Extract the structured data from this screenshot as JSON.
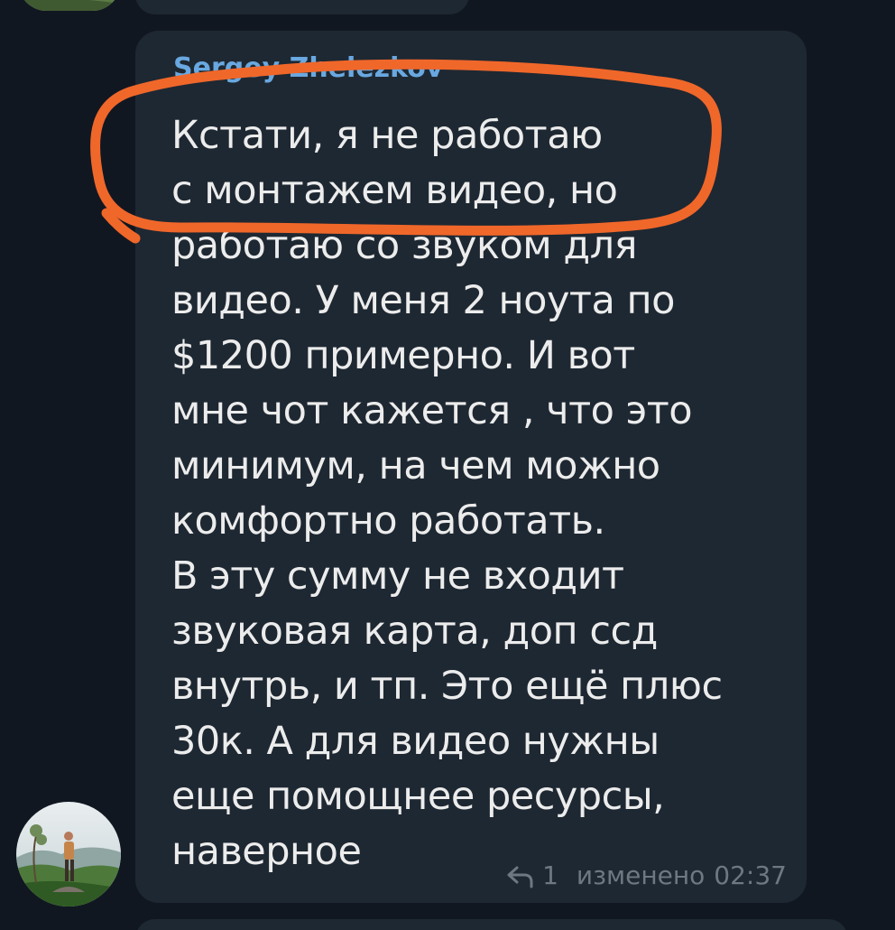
{
  "message": {
    "sender": "Sergey Zhelezkov",
    "text": "Кстати, я не работаю\nс монтажем видео, но\nработаю со звуком для\nвидео. У меня 2 ноута по\n$1200 примерно. И вот\nмне чот кажется , что это\nминимум, на чем можно\nкомфортно работать.\nВ эту сумму не входит\nзвуковая карта, доп ссд\nвнутрь, и тп. Это ещё плюс\n30к. А для видео нужны\nеще помощнее ресурсы,\nнаверное",
    "reply_count": "1",
    "edited_label": "изменено",
    "time": "02:37",
    "reply_icon": "reply-arrow-icon"
  },
  "colors": {
    "background": "#111721",
    "bubble": "#1e2832",
    "sender": "#69a8e0",
    "text": "#ececec",
    "meta": "#6d7883",
    "annotation": "#f0672a"
  }
}
